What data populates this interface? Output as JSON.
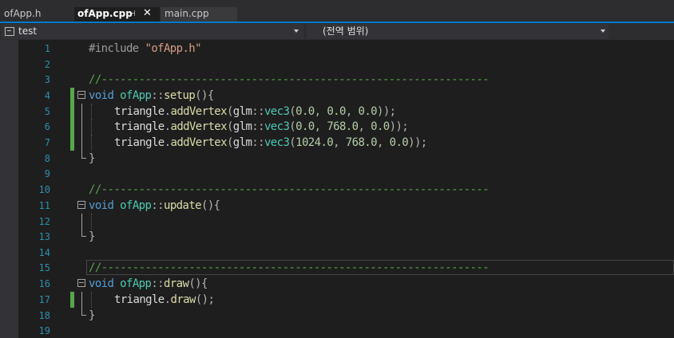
{
  "tabs": [
    {
      "label": "ofApp.h",
      "active": false
    },
    {
      "label": "ofApp.cpp",
      "active": true,
      "pinned": true
    },
    {
      "label": "main.cpp",
      "active": false
    }
  ],
  "navbar": {
    "project": "test",
    "scope": "(전역 범위)"
  },
  "colors": {
    "accent": "#007acc",
    "change_marker": "#57a64a",
    "keyword": "#569cd6",
    "string": "#d69d85",
    "type": "#4ec9b0",
    "function": "#dcdcaa",
    "number": "#b5cea8",
    "comment": "#57a64a",
    "line_number": "#2b91af"
  },
  "lines": [
    {
      "n": "1"
    },
    {
      "n": "2"
    },
    {
      "n": "3"
    },
    {
      "n": "4"
    },
    {
      "n": "5"
    },
    {
      "n": "6"
    },
    {
      "n": "7"
    },
    {
      "n": "8"
    },
    {
      "n": "9"
    },
    {
      "n": "10"
    },
    {
      "n": "11"
    },
    {
      "n": "12"
    },
    {
      "n": "13"
    },
    {
      "n": "14"
    },
    {
      "n": "15"
    },
    {
      "n": "16"
    },
    {
      "n": "17"
    },
    {
      "n": "18"
    },
    {
      "n": "19"
    }
  ],
  "code": {
    "include_directive": "#include",
    "include_file": "\"ofApp.h\"",
    "separator": "//--------------------------------------------------------------",
    "kw_void": "void",
    "class_name": "ofApp",
    "scope_op": "::",
    "fn_setup": "setup",
    "fn_update": "update",
    "fn_draw": "draw",
    "parens_open_brace": "(){",
    "close_brace": "}",
    "var_triangle": "triangle",
    "dot": ".",
    "fn_addVertex": "addVertex",
    "ns_glm": "glm",
    "type_vec3": "vec3",
    "paren_open": "(",
    "paren_close": ")",
    "call_end": "));",
    "call_draw_end": "();",
    "comma": ", ",
    "v1": [
      "0.0",
      "0.0",
      "0.0"
    ],
    "v2": [
      "0.0",
      "768.0",
      "0.0"
    ],
    "v3": [
      "1024.0",
      "768.0",
      "0.0"
    ]
  }
}
